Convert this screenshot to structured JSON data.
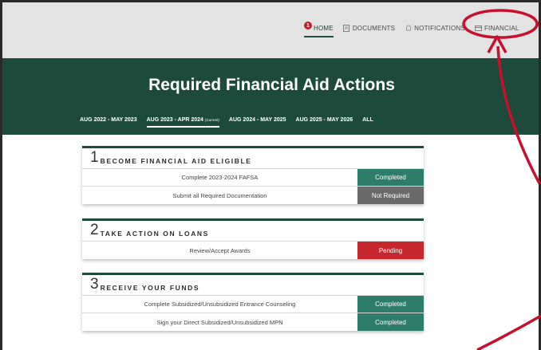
{
  "nav": {
    "badge": "1",
    "items": [
      {
        "label": "HOME",
        "icon": "home-icon"
      },
      {
        "label": "DOCUMENTS",
        "icon": "document-icon"
      },
      {
        "label": "NOTIFICATIONS",
        "icon": "bell-icon"
      },
      {
        "label": "FINANCIAL",
        "icon": "card-icon"
      }
    ]
  },
  "hero": {
    "title": "Required Financial Aid Actions",
    "years": [
      {
        "label": "AUG 2022 - MAY 2023",
        "tag": ""
      },
      {
        "label": "AUG 2023 - APR 2024",
        "tag": "(Current)"
      },
      {
        "label": "AUG 2024 - MAY 2025",
        "tag": ""
      },
      {
        "label": "AUG 2025 - MAY 2026",
        "tag": ""
      },
      {
        "label": "ALL",
        "tag": ""
      }
    ]
  },
  "sections": [
    {
      "number": "1",
      "title": "BECOME FINANCIAL AID ELIGIBLE",
      "rows": [
        {
          "label": "Complete 2023-2024 FAFSA",
          "status": "Completed"
        },
        {
          "label": "Submit all Required Documentation",
          "status": "Not Required"
        }
      ]
    },
    {
      "number": "2",
      "title": "TAKE ACTION ON LOANS",
      "rows": [
        {
          "label": "Review/Accept Awards",
          "status": "Pending"
        }
      ]
    },
    {
      "number": "3",
      "title": "RECEIVE YOUR FUNDS",
      "rows": [
        {
          "label": "Complete Subsidized/Unsubsidized Entrance Counseling",
          "status": "Completed"
        },
        {
          "label": "Sign your Direct Subsidized/Unsubsidized MPN",
          "status": "Completed"
        }
      ]
    }
  ],
  "colors": {
    "brand": "#1e4a3c",
    "completed": "#2e7d6b",
    "not_required": "#6a6a6a",
    "pending": "#c7282f",
    "annotation": "#c8102e"
  }
}
